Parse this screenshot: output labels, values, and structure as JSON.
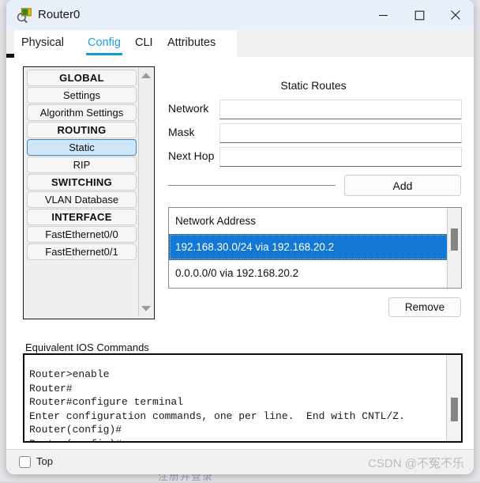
{
  "window": {
    "title": "Router0",
    "icon": "router-magnifier-icon",
    "minimize_label": "—",
    "maximize_label": "☐",
    "close_label": "✕"
  },
  "tabs": [
    {
      "label": "Physical",
      "active": false
    },
    {
      "label": "Config",
      "active": true
    },
    {
      "label": "CLI",
      "active": false
    },
    {
      "label": "Attributes",
      "active": false
    }
  ],
  "sidebar": {
    "items": [
      {
        "label": "GLOBAL",
        "type": "header",
        "selected": false
      },
      {
        "label": "Settings",
        "type": "item",
        "selected": false
      },
      {
        "label": "Algorithm Settings",
        "type": "item",
        "selected": false
      },
      {
        "label": "ROUTING",
        "type": "header",
        "selected": false
      },
      {
        "label": "Static",
        "type": "item",
        "selected": true
      },
      {
        "label": "RIP",
        "type": "item",
        "selected": false
      },
      {
        "label": "SWITCHING",
        "type": "header",
        "selected": false
      },
      {
        "label": "VLAN Database",
        "type": "item",
        "selected": false
      },
      {
        "label": "INTERFACE",
        "type": "header",
        "selected": false
      },
      {
        "label": "FastEthernet0/0",
        "type": "item",
        "selected": false
      },
      {
        "label": "FastEthernet0/1",
        "type": "item",
        "selected": false
      }
    ]
  },
  "static_routes": {
    "panel_title": "Static Routes",
    "fields": [
      {
        "label": "Network",
        "value": "",
        "placeholder": ""
      },
      {
        "label": "Mask",
        "value": "",
        "placeholder": ""
      },
      {
        "label": "Next Hop",
        "value": "",
        "placeholder": ""
      }
    ],
    "add_label": "Add",
    "remove_label": "Remove",
    "list_header": "Network Address",
    "routes": [
      {
        "text": "192.168.30.0/24 via 192.168.20.2",
        "selected": true
      },
      {
        "text": "0.0.0.0/0 via 192.168.20.2",
        "selected": false
      }
    ]
  },
  "ios": {
    "label": "Equivalent IOS Commands",
    "text": "Router>enable\nRouter#\nRouter#configure terminal\nEnter configuration commands, one per line.  End with CNTL/Z.\nRouter(config)#\nRouter(config)#"
  },
  "footer": {
    "top_label": "Top",
    "watermark": "CSDN @不冤不乐"
  },
  "background": {
    "text": "注册并登录"
  },
  "colors": {
    "accent": "#0f9fd8",
    "selection": "#1278d4",
    "titlebar": "#eaf0f9",
    "sidebar_selected": "#cfe6f8"
  }
}
